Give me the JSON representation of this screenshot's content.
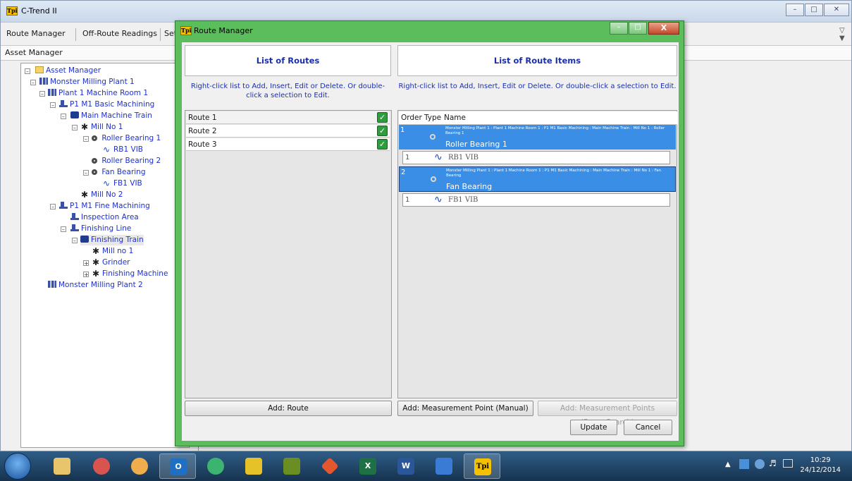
{
  "app": {
    "title": "C-Trend II",
    "icon": "tpi-logo-icon"
  },
  "toolbar": {
    "route_manager": "Route Manager",
    "off_route": "Off-Route Readings",
    "setup": "Setu"
  },
  "asset_manager_label": "Asset Manager",
  "tree": {
    "items": [
      {
        "label": "Asset Manager",
        "icon": "folder-icon"
      },
      {
        "label": "Monster Milling Plant 1",
        "icon": "plant-icon"
      },
      {
        "label": "Plant 1 Machine Room 1",
        "icon": "machine-room-icon"
      },
      {
        "label": "P1 M1 Basic Machining",
        "icon": "machining-icon"
      },
      {
        "label": "Main Machine Train",
        "icon": "train-icon"
      },
      {
        "label": "Mill No 1",
        "icon": "fan-icon"
      },
      {
        "label": "Roller Bearing 1",
        "icon": "bearing-icon"
      },
      {
        "label": "RB1 VIB",
        "icon": "vibration-wave-icon"
      },
      {
        "label": "Roller Bearing 2",
        "icon": "bearing-icon"
      },
      {
        "label": "Fan Bearing",
        "icon": "bearing-icon"
      },
      {
        "label": "FB1 VIB",
        "icon": "vibration-wave-icon"
      },
      {
        "label": "Mill No 2",
        "icon": "fan-icon"
      },
      {
        "label": "P1 M1 Fine Machining",
        "icon": "machining-icon"
      },
      {
        "label": "Inspection Area",
        "icon": "area-icon"
      },
      {
        "label": "Finishing Line",
        "icon": "line-icon"
      },
      {
        "label": "Finishing Train",
        "icon": "train-icon"
      },
      {
        "label": "Mill no 1",
        "icon": "fan-icon"
      },
      {
        "label": "Grinder",
        "icon": "fan-icon"
      },
      {
        "label": "Finishing Machine",
        "icon": "fan-icon"
      },
      {
        "label": "Monster Milling Plant 2",
        "icon": "plant-icon"
      }
    ]
  },
  "dialog": {
    "title": "Route Manager",
    "close": "X",
    "routes_header": "List of Routes",
    "routes_hint": "Right-click list to Add, Insert, Edit or Delete. Or double-click a selection to Edit.",
    "routes": [
      {
        "name": "Route 1",
        "checked": true
      },
      {
        "name": "Route 2",
        "checked": true
      },
      {
        "name": "Route 3",
        "checked": true
      }
    ],
    "items_header": "List of Route Items",
    "items_hint": "Right-click list to Add, Insert, Edit or Delete. Or double-click a selection to Edit.",
    "columns": {
      "order": "Order",
      "type": "Type",
      "name": "Name"
    },
    "items": [
      {
        "order": "1",
        "path": "Monster Milling Plant 1 : Plant 1 Machine Room 1 : P1 M1 Basic Machining : Main Machine Train : Mill No 1 : Roller Bearing 1",
        "name": "Roller Bearing 1",
        "sub": {
          "order": "1",
          "name": "RB1 VIB"
        }
      },
      {
        "order": "2",
        "path": "Monster Milling Plant 1 : Plant 1 Machine Room 1 : P1 M1 Basic Machining : Main Machine Train : Mill No 1 : Fan Bearing",
        "name": "Fan Bearing",
        "sub": {
          "order": "1",
          "name": "FB1 VIB"
        }
      }
    ],
    "add_route": "Add: Route",
    "add_manual": "Add: Measurement Point (Manual)",
    "add_power": "Add: Measurement Points (PowerSearch)",
    "update": "Update",
    "cancel": "Cancel"
  },
  "taskbar": {
    "apps": [
      {
        "icon": "file-explorer-icon"
      },
      {
        "icon": "paint-icon"
      },
      {
        "icon": "chrome-icon"
      },
      {
        "icon": "outlook-icon",
        "text": "O"
      },
      {
        "icon": "media-icon"
      },
      {
        "icon": "vector-app-icon"
      },
      {
        "icon": "spreadsheet-app-icon"
      },
      {
        "icon": "git-icon"
      },
      {
        "icon": "excel-icon",
        "text": "X"
      },
      {
        "icon": "word-icon",
        "text": "W"
      },
      {
        "icon": "remote-desktop-icon"
      },
      {
        "icon": "ctrend-icon",
        "text": "Tpi"
      }
    ],
    "time": "10:29",
    "date": "24/12/2014"
  },
  "colors": {
    "selection": "#3a8ee6",
    "dialog_frame": "#5cbd5c",
    "link_text": "#1f2fd0",
    "header_text": "#1c2fa8"
  }
}
